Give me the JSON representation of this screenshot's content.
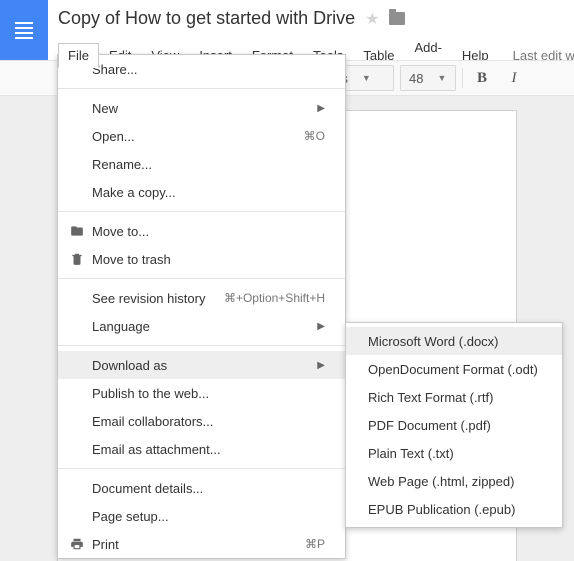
{
  "doc": {
    "title": "Copy of How to get started with Drive",
    "last_edit": "Last edit was s"
  },
  "menubar": {
    "file": "File",
    "edit": "Edit",
    "view": "View",
    "insert": "Insert",
    "format": "Format",
    "tools": "Tools",
    "table": "Table",
    "addons": "Add-ons",
    "help": "Help"
  },
  "toolbar": {
    "font": "Times",
    "size": "48",
    "bold": "B",
    "italic": "I"
  },
  "file_menu": {
    "share": "Share...",
    "new": "New",
    "open": "Open...",
    "open_shortcut": "⌘O",
    "rename": "Rename...",
    "make_copy": "Make a copy...",
    "move_to": "Move to...",
    "move_trash": "Move to trash",
    "revision": "See revision history",
    "revision_shortcut": "⌘+Option+Shift+H",
    "language": "Language",
    "download_as": "Download as",
    "publish": "Publish to the web...",
    "email_collab": "Email collaborators...",
    "email_attach": "Email as attachment...",
    "doc_details": "Document details...",
    "page_setup": "Page setup...",
    "print": "Print",
    "print_shortcut": "⌘P"
  },
  "download_submenu": {
    "docx": "Microsoft Word (.docx)",
    "odt": "OpenDocument Format (.odt)",
    "rtf": "Rich Text Format (.rtf)",
    "pdf": "PDF Document (.pdf)",
    "txt": "Plain Text (.txt)",
    "html": "Web Page (.html, zipped)",
    "epub": "EPUB Publication (.epub)"
  }
}
